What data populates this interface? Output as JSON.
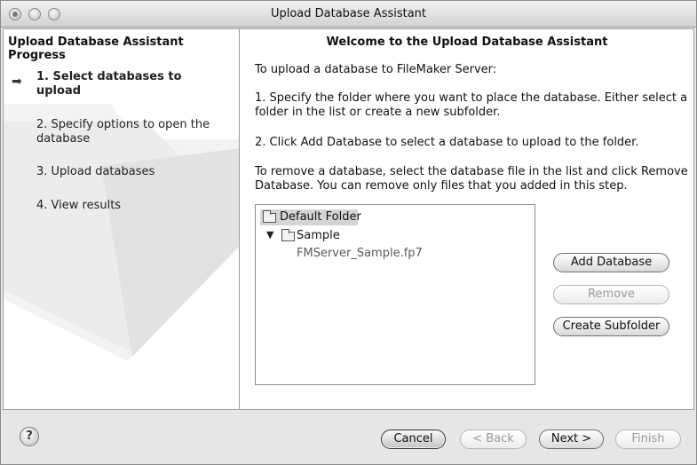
{
  "window": {
    "title": "Upload Database Assistant"
  },
  "sidebar": {
    "title": "Upload Database Assistant Progress",
    "steps": [
      {
        "label": "1. Select databases to upload",
        "current": true
      },
      {
        "label": "2. Specify options to open the database",
        "current": false
      },
      {
        "label": "3. Upload databases",
        "current": false
      },
      {
        "label": "4. View results",
        "current": false
      }
    ]
  },
  "main": {
    "title": "Welcome to the Upload Database Assistant",
    "paragraphs": [
      "To upload a database to FileMaker Server:",
      "1.  Specify the folder where you want to place the database. Either select a folder in the list or create a new subfolder.",
      "2.  Click Add Database to select a database to upload to the folder.",
      "To remove a database, select the database file in the list and click Remove Database. You can remove only files that you added in this step."
    ],
    "tree": {
      "root": "Default Folder",
      "folder": "Sample",
      "file": "FMServer_Sample.fp7"
    },
    "buttons": {
      "add": "Add Database",
      "remove": "Remove",
      "subfolder": "Create Subfolder"
    }
  },
  "footer": {
    "help": "?",
    "cancel": "Cancel",
    "back": "< Back",
    "next": "Next >",
    "finish": "Finish"
  },
  "icons": {
    "current_step": "arrow-right-icon",
    "disclosure": "triangle-down-icon",
    "folder": "folder-icon",
    "help": "help-icon"
  }
}
